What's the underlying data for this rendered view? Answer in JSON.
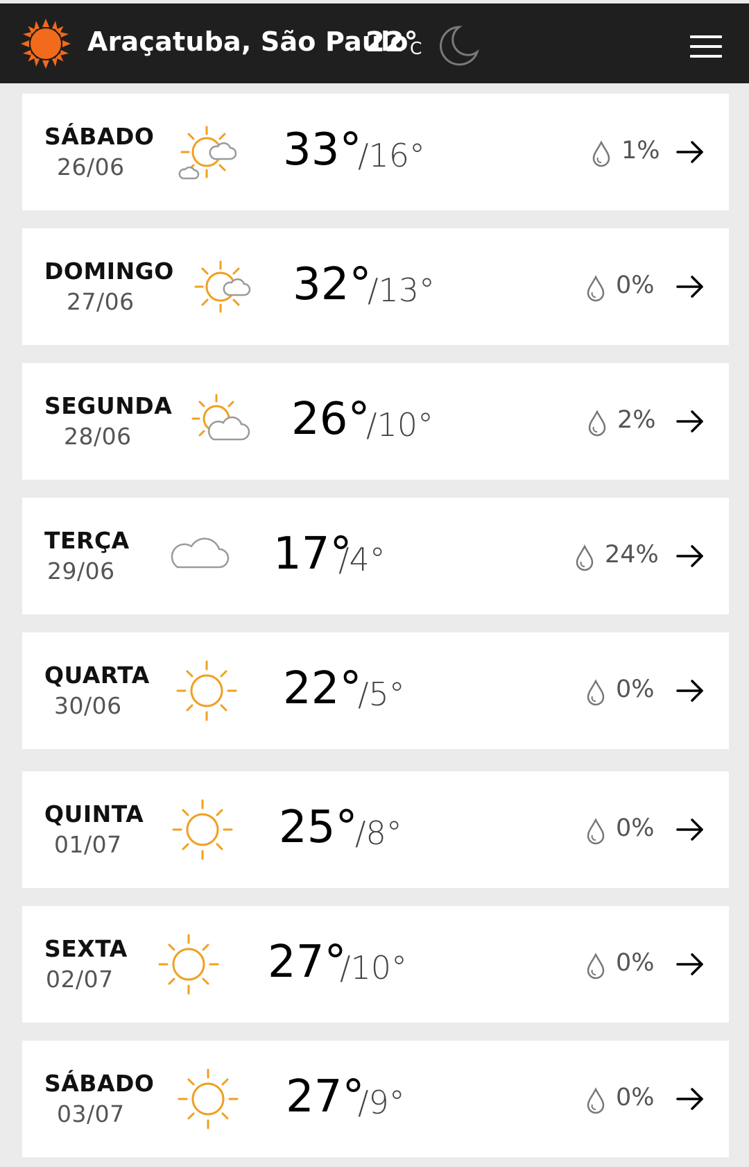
{
  "header": {
    "location": "Araçatuba, São Paulo",
    "current_temp": "22°",
    "unit": "C",
    "brand_color": "#f26a1b",
    "icons": [
      "sun-logo-icon",
      "moon-icon",
      "menu-icon"
    ]
  },
  "forecast": [
    {
      "day": "SÁBADO",
      "date": "26/06",
      "condition": "sun-cloud-small",
      "max": "33°",
      "min": "/16°",
      "precip": "1%"
    },
    {
      "day": "DOMINGO",
      "date": "27/06",
      "condition": "sun-cloud-small",
      "max": "32°",
      "min": "/13°",
      "precip": "0%"
    },
    {
      "day": "SEGUNDA",
      "date": "28/06",
      "condition": "sun-cloud",
      "max": "26°",
      "min": "/10°",
      "precip": "2%"
    },
    {
      "day": "TERÇA",
      "date": "29/06",
      "condition": "cloud",
      "max": "17°",
      "min": "/4°",
      "precip": "24%"
    },
    {
      "day": "QUARTA",
      "date": "30/06",
      "condition": "sun",
      "max": "22°",
      "min": "/5°",
      "precip": "0%"
    },
    {
      "day": "QUINTA",
      "date": "01/07",
      "condition": "sun",
      "max": "25°",
      "min": "/8°",
      "precip": "0%"
    },
    {
      "day": "SEXTA",
      "date": "02/07",
      "condition": "sun",
      "max": "27°",
      "min": "/10°",
      "precip": "0%"
    },
    {
      "day": "SÁBADO",
      "date": "03/07",
      "condition": "sun",
      "max": "27°",
      "min": "/9°",
      "precip": "0%"
    }
  ],
  "colors": {
    "sun": "#f0a020",
    "cloud": "#9a9a9a",
    "header_bg": "#1f1f1f"
  }
}
